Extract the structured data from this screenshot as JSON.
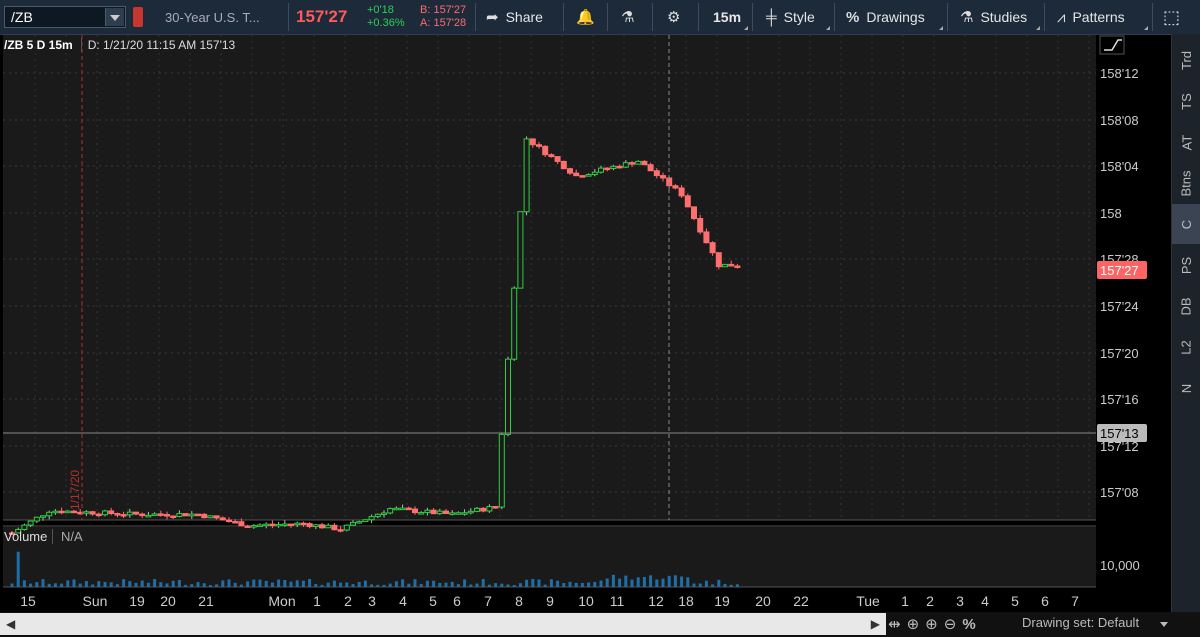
{
  "toolbar": {
    "symbol": "/ZB",
    "description": "30-Year U.S. T...",
    "last": "157'27",
    "change": "+0'18",
    "change_pct": "+0.36%",
    "bid": "B: 157'27",
    "ask": "A: 157'28",
    "share": "Share",
    "timeframe": "15m",
    "style": "Style",
    "drawings": "Drawings",
    "studies": "Studies",
    "patterns": "Patterns"
  },
  "header": {
    "title": "/ZB 5 D 15m",
    "info": "D: 1/21/20 11:15 AM  157'13"
  },
  "price_axis": {
    "labels": [
      "158'12",
      "158'08",
      "158'04",
      "158",
      "157'28",
      "157'24",
      "157'20",
      "157'16",
      "157'12",
      "157'08"
    ],
    "last_tag": "157'27",
    "cursor_tag": "157'13"
  },
  "day_marker": "1/17/20",
  "volume": {
    "label": "Volume",
    "value": "N/A",
    "axis_label": "10,000"
  },
  "time_axis": [
    "15",
    "Sun",
    "19",
    "20",
    "21",
    "Mon",
    "1",
    "2",
    "3",
    "4",
    "5",
    "6",
    "7",
    "8",
    "9",
    "10",
    "11",
    "12",
    "18",
    "19",
    "20",
    "22",
    "Tue",
    "1",
    "2",
    "3",
    "4",
    "5",
    "6",
    "7"
  ],
  "sidebar": [
    "Trd",
    "TS",
    "AT",
    "Btns",
    "C",
    "PS",
    "DB",
    "L2",
    "N"
  ],
  "bottom": {
    "drawing_set": "Drawing set: Default"
  },
  "colors": {
    "up": "#2fcf3f",
    "down": "#ff6f6f",
    "background": "#1a1a1a",
    "toolbar": "#1c2a3a",
    "price_tag": "#ff6464"
  },
  "icons": [
    "share-icon",
    "alert-icon",
    "flask-icon",
    "gear-icon",
    "candle-style-icon",
    "percent-icon",
    "pencil-icon",
    "patterns-icon",
    "expand-icon"
  ]
}
